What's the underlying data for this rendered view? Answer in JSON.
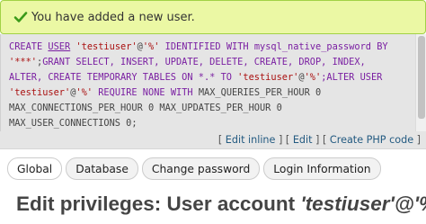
{
  "success": {
    "icon": "check-icon",
    "message": "You have added a new user."
  },
  "sql": {
    "lines": [
      [
        {
          "t": "CREATE ",
          "c": "kw"
        },
        {
          "t": "USER",
          "c": "kw-u"
        },
        {
          "t": " ",
          "c": "sym"
        },
        {
          "t": "'testiuser'",
          "c": "str"
        },
        {
          "t": "@",
          "c": "sym"
        },
        {
          "t": "'%'",
          "c": "str"
        },
        {
          "t": " IDENTIFIED WITH mysql_native_password BY",
          "c": "kw"
        }
      ],
      [
        {
          "t": "'***'",
          "c": "str"
        },
        {
          "t": ";",
          "c": "sym"
        },
        {
          "t": "GRANT SELECT, INSERT, UPDATE, DELETE, CREATE, DROP, INDEX,",
          "c": "kw"
        }
      ],
      [
        {
          "t": "ALTER, CREATE TEMPORARY TABLES ON *.* TO ",
          "c": "kw"
        },
        {
          "t": "'testiuser'",
          "c": "str"
        },
        {
          "t": "@",
          "c": "sym"
        },
        {
          "t": "'%'",
          "c": "str"
        },
        {
          "t": ";ALTER USER",
          "c": "kw"
        }
      ],
      [
        {
          "t": "'testiuser'",
          "c": "str"
        },
        {
          "t": "@",
          "c": "sym"
        },
        {
          "t": "'%'",
          "c": "str"
        },
        {
          "t": " REQUIRE NONE ",
          "c": "kw"
        },
        {
          "t": "WITH",
          "c": "kw"
        },
        {
          "t": " MAX_QUERIES_PER_HOUR 0",
          "c": "sym"
        }
      ],
      [
        {
          "t": "MAX_CONNECTIONS_PER_HOUR 0 MAX_UPDATES_PER_HOUR 0",
          "c": "sym"
        }
      ],
      [
        {
          "t": "MAX_USER_CONNECTIONS 0;",
          "c": "sym"
        }
      ]
    ]
  },
  "actions": {
    "edit_inline": "Edit inline",
    "edit": "Edit",
    "create_php_code": "Create PHP code"
  },
  "tabs": [
    {
      "label": "Global",
      "active": true
    },
    {
      "label": "Database",
      "active": false
    },
    {
      "label": "Change password",
      "active": false
    },
    {
      "label": "Login Information",
      "active": false
    }
  ],
  "heading": {
    "prefix": "Edit privileges: User account ",
    "account": "'testiuser'@'%'"
  }
}
